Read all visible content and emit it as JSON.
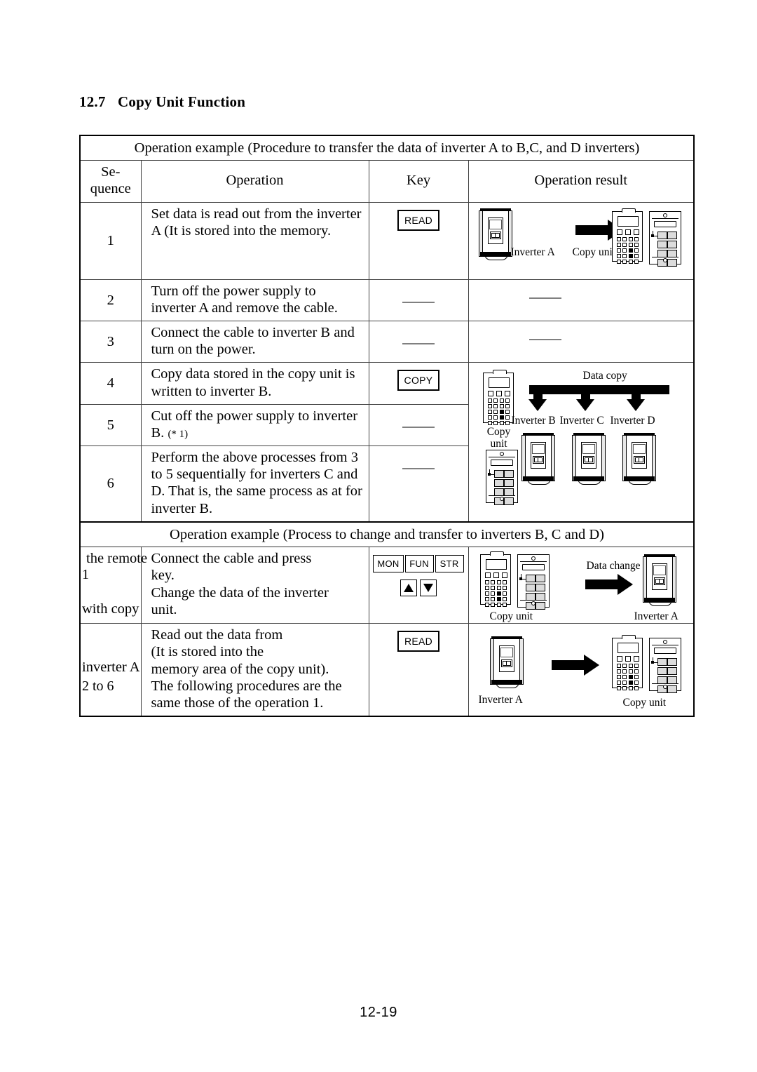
{
  "document": {
    "section_number": "12.7",
    "section_title": "Copy Unit Function",
    "page_number": "12-19"
  },
  "table1": {
    "title": "Operation example (Procedure to transfer the data of inverter A to B,C, and D inverters)",
    "headers": {
      "sequence": "Se-\nquence",
      "sequence_line1": "Se-",
      "sequence_line2": "quence",
      "operation": "Operation",
      "key": "Key",
      "result": "Operation result"
    },
    "rows": [
      {
        "seq": "1",
        "operation": "Set data is read out from the inverter A (It is stored into the memory.",
        "key_label": "READ",
        "key_type": "button",
        "result_type": "diagram-read",
        "result_labels": {
          "source": "Inverter A",
          "target": "Copy unit"
        }
      },
      {
        "seq": "2",
        "operation": "Turn off the power supply to inverter A and remove the cable.",
        "key_label": "",
        "key_type": "dash",
        "result_type": "dash"
      },
      {
        "seq": "3",
        "operation": "Connect the cable to inverter B and turn on the power.",
        "key_label": "",
        "key_type": "dash",
        "result_type": "dash"
      },
      {
        "seq": "4",
        "operation": "Copy data stored in the copy unit is written to inverter B.",
        "key_label": "COPY",
        "key_type": "button",
        "result_type": "diagram-copy",
        "result_labels": {
          "source": "Copy\nunit",
          "source_line1": "Copy",
          "source_line2": "unit",
          "bus": "Data copy",
          "targets": [
            "Inverter B",
            "Inverter C",
            "Inverter D"
          ]
        }
      },
      {
        "seq": "5",
        "operation": "Cut off the power supply to inverter B.",
        "operation_note": "(* 1)",
        "key_label": "",
        "key_type": "dash",
        "result_type": "none"
      },
      {
        "seq": "6",
        "operation": "Perform the above processes from 3 to 5 sequentially for inverters C and D.  That is, the same process as at for inverter B.",
        "key_label": "",
        "key_type": "dash",
        "result_type": "none"
      }
    ]
  },
  "table2": {
    "title": "Operation example (Process to change and transfer to inverters B, C and D)",
    "rows": [
      {
        "seq": "1",
        "seq_overflow_line1": "the remote",
        "seq_overflow_line2": "with copy",
        "operation": "Connect the cable and press key.\nChange the data of the inverter unit.",
        "operation_line1": "Connect the cable and press",
        "operation_line2": "key.",
        "operation_line3": "Change the data of the inverter",
        "operation_line4": "unit.",
        "keys_row1": [
          "MON",
          "FUN",
          "STR"
        ],
        "keys_row2": [
          "up-arrow",
          "down-arrow"
        ],
        "result_type": "diagram-change",
        "result_labels": {
          "source": "Copy unit",
          "bus": "Data change",
          "target": "Inverter A"
        }
      },
      {
        "seq": "2 to 6",
        "seq_overflow_line1": "inverter A",
        "operation_line1": "Read out the data from",
        "operation_line2": "(It is stored into the",
        "operation_line3": "memory area of the copy unit).",
        "operation_line4": "The following procedures are the",
        "operation_line5": "same those of the operation 1.",
        "key_label": "READ",
        "key_type": "button",
        "result_type": "diagram-read2",
        "result_labels": {
          "source": "Inverter A",
          "target": "Copy unit"
        }
      }
    ]
  }
}
